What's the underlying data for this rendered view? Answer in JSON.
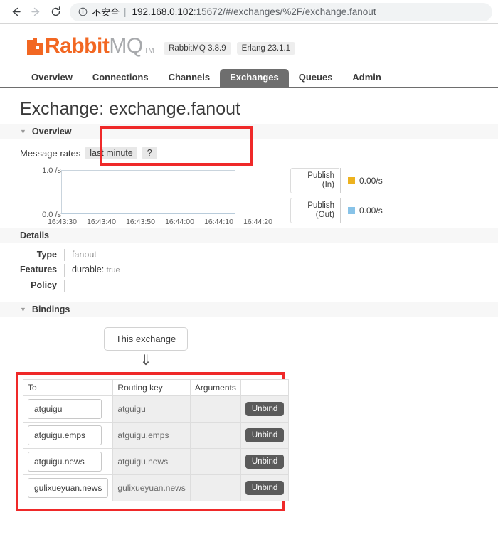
{
  "browser": {
    "back_icon": "back-arrow-icon",
    "forward_icon": "forward-arrow-icon",
    "reload_icon": "reload-icon",
    "info_icon": "info-circle-icon",
    "security_label": "不安全",
    "divider": "|",
    "url_host": "192.168.0.102",
    "url_path": ":15672/#/exchanges/%2F/exchange.fanout"
  },
  "branding": {
    "logo_rabbit": "Rabbit",
    "logo_mq": "MQ",
    "logo_tm": "TM",
    "badges": [
      "RabbitMQ 3.8.9",
      "Erlang 23.1.1"
    ]
  },
  "nav": {
    "tabs": [
      {
        "label": "Overview",
        "active": false
      },
      {
        "label": "Connections",
        "active": false
      },
      {
        "label": "Channels",
        "active": false
      },
      {
        "label": "Exchanges",
        "active": true
      },
      {
        "label": "Queues",
        "active": false
      },
      {
        "label": "Admin",
        "active": false
      }
    ]
  },
  "page": {
    "title_prefix": "Exchange:",
    "title_name": "exchange.fanout"
  },
  "overview": {
    "section_label": "Overview",
    "rates_label": "Message rates",
    "period_chip": "last minute",
    "help_chip": "?"
  },
  "chart_data": {
    "type": "line",
    "title": "Message rates",
    "xlabel": "",
    "ylabel": "/s",
    "ylim": [
      0.0,
      1.0
    ],
    "ytick_labels": [
      "1.0 /s",
      "0.0 /s"
    ],
    "x": [
      "16:43:30",
      "16:43:40",
      "16:43:50",
      "16:44:00",
      "16:44:10",
      "16:44:20"
    ],
    "grid": false,
    "legend_position": "right",
    "series": [
      {
        "name": "Publish (In)",
        "color": "#edb21f",
        "values": [
          0,
          0,
          0,
          0,
          0,
          0
        ],
        "current": "0.00/s"
      },
      {
        "name": "Publish (Out)",
        "color": "#88c3e8",
        "values": [
          0,
          0,
          0,
          0,
          0,
          0
        ],
        "current": "0.00/s"
      }
    ]
  },
  "rates": [
    {
      "name_line1": "Publish",
      "name_line2": "(In)",
      "value": "0.00/s",
      "color": "#edb21f"
    },
    {
      "name_line1": "Publish",
      "name_line2": "(Out)",
      "value": "0.00/s",
      "color": "#88c3e8"
    }
  ],
  "details": {
    "section_label": "Details",
    "type_key": "Type",
    "type_val": "fanout",
    "features_key": "Features",
    "features_name": "durable:",
    "features_value": "true",
    "policy_key": "Policy",
    "policy_val": ""
  },
  "bindings": {
    "section_label": "Bindings",
    "this_exchange": "This exchange",
    "arrow": "⇓",
    "headers": [
      "To",
      "Routing key",
      "Arguments",
      ""
    ],
    "rows": [
      {
        "to": "atguigu",
        "routing_key": "atguigu",
        "arguments": "",
        "action": "Unbind"
      },
      {
        "to": "atguigu.emps",
        "routing_key": "atguigu.emps",
        "arguments": "",
        "action": "Unbind"
      },
      {
        "to": "atguigu.news",
        "routing_key": "atguigu.news",
        "arguments": "",
        "action": "Unbind"
      },
      {
        "to": "gulixueyuan.news",
        "routing_key": "gulixueyuan.news",
        "arguments": "",
        "action": "Unbind"
      }
    ]
  }
}
